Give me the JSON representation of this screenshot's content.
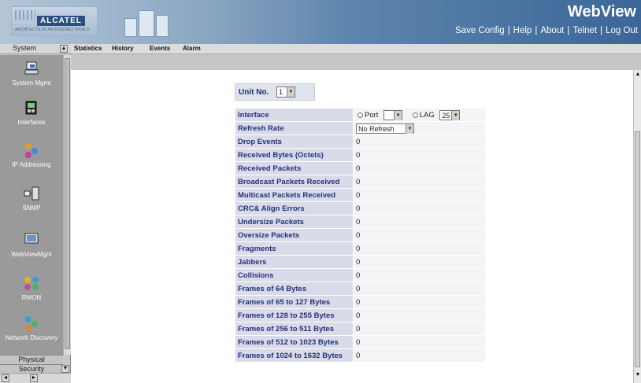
{
  "header": {
    "brand": "WebView",
    "logo_text": "ALCATEL",
    "logo_sub": "ARCHITECTS OF AN INTERNET WORLD",
    "nav": [
      {
        "label": "Save Config"
      },
      {
        "label": "Help"
      },
      {
        "label": "About"
      },
      {
        "label": "Telnet"
      },
      {
        "label": "Log Out"
      }
    ],
    "nav_sep": "|"
  },
  "sidebar": {
    "title": "System",
    "items": [
      {
        "label": "System Mgmt",
        "icon": "system-mgmt-icon"
      },
      {
        "label": "Interfaces",
        "icon": "interfaces-icon"
      },
      {
        "label": "IP Addressing",
        "icon": "ip-addressing-icon"
      },
      {
        "label": "SNMP",
        "icon": "snmp-icon"
      },
      {
        "label": "WebViewMgm",
        "icon": "webview-mgmt-icon"
      },
      {
        "label": "RMON",
        "icon": "rmon-icon"
      },
      {
        "label": "Network Discovery",
        "icon": "network-discovery-icon"
      }
    ],
    "panels": [
      {
        "label": "Physical"
      },
      {
        "label": "Security"
      }
    ],
    "scroll_up": "▲",
    "scroll_down": "▼",
    "scroll_left": "◄",
    "scroll_right": "►"
  },
  "tabs": [
    {
      "label": "Statistics"
    },
    {
      "label": "History"
    },
    {
      "label": "Events"
    },
    {
      "label": "Alarm"
    }
  ],
  "main": {
    "unit_label": "Unit No.",
    "unit_value": "1",
    "dropdown_arrow": "▼",
    "interface": {
      "label": "Interface",
      "port_label": "Port",
      "lag_label": "LAG",
      "lag_value": "25"
    },
    "refresh": {
      "label": "Refresh Rate",
      "value": "No Refresh"
    },
    "rows": [
      {
        "label": "Drop Events",
        "value": "0"
      },
      {
        "label": "Received Bytes (Octets)",
        "value": "0"
      },
      {
        "label": "Received Packets",
        "value": "0"
      },
      {
        "label": "Broadcast Packets Received",
        "value": "0"
      },
      {
        "label": "Multicast Packets Received",
        "value": "0"
      },
      {
        "label": "CRC& Align Errors",
        "value": "0"
      },
      {
        "label": "Undersize Packets",
        "value": "0"
      },
      {
        "label": "Oversize Packets",
        "value": "0"
      },
      {
        "label": "Fragments",
        "value": "0"
      },
      {
        "label": "Jabbers",
        "value": "0"
      },
      {
        "label": "Collisions",
        "value": "0"
      },
      {
        "label": "Frames of 64 Bytes",
        "value": "0"
      },
      {
        "label": "Frames of 65 to 127 Bytes",
        "value": "0"
      },
      {
        "label": "Frames of 128 to 255 Bytes",
        "value": "0"
      },
      {
        "label": "Frames of 256 to 511 Bytes",
        "value": "0"
      },
      {
        "label": "Frames of 512 to 1023 Bytes",
        "value": "0"
      },
      {
        "label": "Frames of 1024 to 1632 Bytes",
        "value": "0"
      }
    ]
  }
}
